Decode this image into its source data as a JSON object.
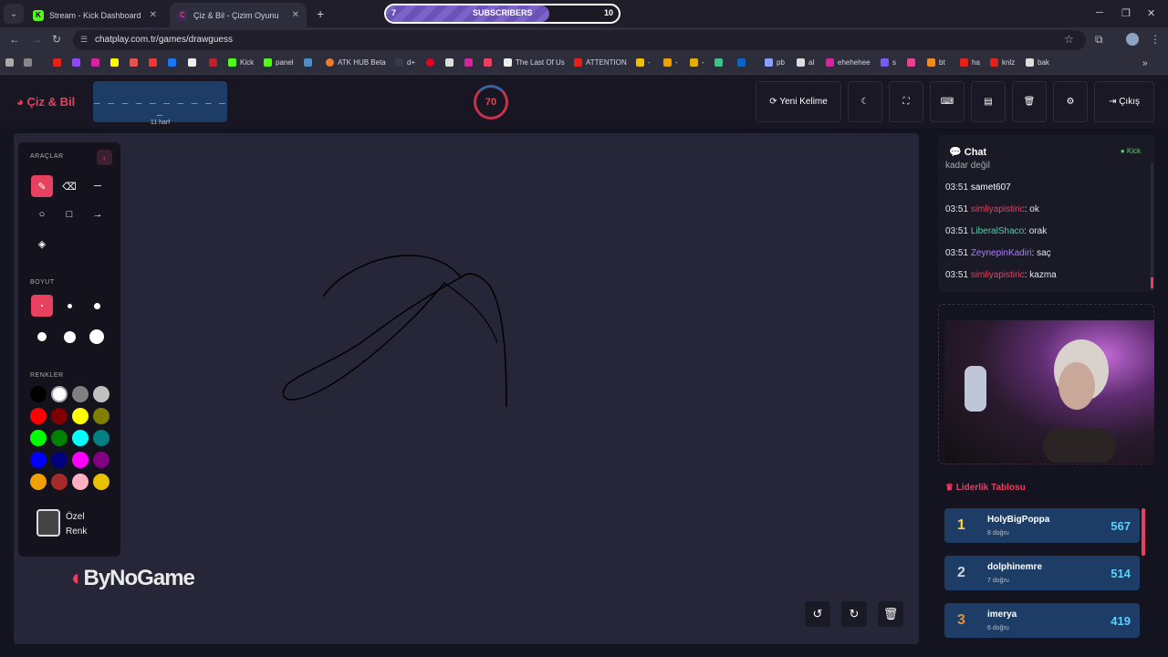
{
  "browser": {
    "tabs": [
      {
        "title": "Stream - Kick Dashboard",
        "favicon": "kick-icon",
        "active": false
      },
      {
        "title": "Çiz & Bil - Çizim Oyunu",
        "favicon": "chatplay-icon",
        "active": true
      }
    ],
    "subscribers": {
      "label": "SUBSCRIBERS",
      "current": "7",
      "goal": "10",
      "progress": 0.7
    },
    "url": "chatplay.com.tr/games/drawguess",
    "bookmarks": [
      "Kick",
      "panel",
      "ATK HUB Beta",
      "d+",
      "The Last Of Us",
      "ATTENTION",
      "-",
      "-",
      "-",
      "pb",
      "al",
      "ehehehee",
      "s",
      "bt",
      "ha",
      "knlz",
      "bak"
    ]
  },
  "header": {
    "logo": "Çiz & Bil",
    "word_mask": "_ _ _ _ _ _ _ _ _ _ _",
    "word_count": "11 harf",
    "timer": "70",
    "new_word": "Yeni Kelime",
    "logout": "Çıkış"
  },
  "tools": {
    "tools_title": "ARAÇLAR",
    "size_title": "BOYUT",
    "colors_title": "RENKLER",
    "custom_color": "Özel Renk",
    "colors": [
      "#000000",
      "#ffffff",
      "#808080",
      "#c0c0c0",
      "#ff0000",
      "#800000",
      "#ffff00",
      "#808000",
      "#00ff00",
      "#008000",
      "#00ffff",
      "#008080",
      "#0000ff",
      "#000080",
      "#ff00ff",
      "#800080",
      "#f0a000",
      "#a52a2a",
      "#ffb0c0",
      "#e6c200"
    ]
  },
  "brand": "ByNoGame",
  "chat": {
    "title": "Chat",
    "source": "Kick",
    "partial_top": "kadar değil",
    "messages": [
      {
        "time": "03:51",
        "user": "samet607",
        "text": "",
        "color": "#ffffff"
      },
      {
        "time": "03:51",
        "user": "simliyapistiric",
        "text": ": ok",
        "color": "#e8415f"
      },
      {
        "time": "03:51",
        "user": "LiberalShaco",
        "text": ": orak",
        "color": "#4fd1a5"
      },
      {
        "time": "03:51",
        "user": "ZeynepinKadiri",
        "text": ": saç",
        "color": "#b07cff"
      },
      {
        "time": "03:51",
        "user": "simliyapistiric",
        "text": ": kazma",
        "color": "#e8415f"
      }
    ]
  },
  "leaderboard": {
    "title": "Liderlik Tablosu",
    "entries": [
      {
        "rank": "1",
        "name": "HolyBigPoppa",
        "correct": "8 doğru",
        "score": "567",
        "color": "#ffd23c"
      },
      {
        "rank": "2",
        "name": "dolphinemre",
        "correct": "7 doğru",
        "score": "514",
        "color": "#cfd6e0"
      },
      {
        "rank": "3",
        "name": "imerya",
        "correct": "6 doğru",
        "score": "419",
        "color": "#e09040"
      }
    ]
  }
}
